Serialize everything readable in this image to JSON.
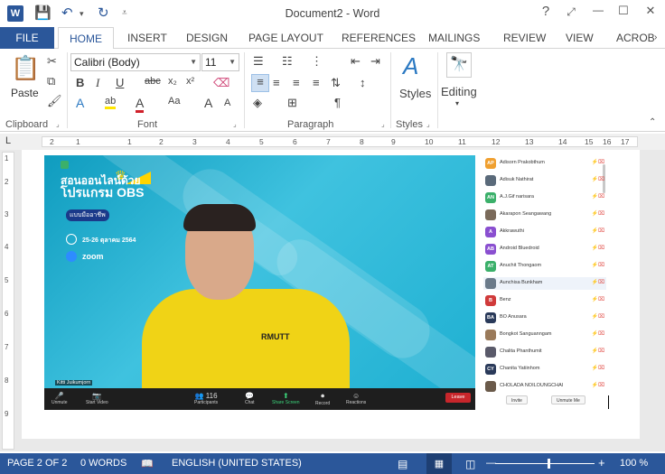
{
  "titlebar": {
    "app_icon": "W",
    "title": "Document2 - Word",
    "help": "?",
    "restore_ribbon": "⤢",
    "minimize": "—",
    "maximize": "☐",
    "close": "✕"
  },
  "tabs": {
    "file": "FILE",
    "items": [
      "HOME",
      "INSERT",
      "DESIGN",
      "PAGE LAYOUT",
      "REFERENCES",
      "MAILINGS",
      "REVIEW",
      "VIEW",
      "ACROB"
    ]
  },
  "ribbon": {
    "clipboard": {
      "paste": "Paste",
      "label": "Clipboard"
    },
    "font": {
      "name": "Calibri (Body)",
      "size": "11",
      "label": "Font"
    },
    "paragraph": {
      "label": "Paragraph"
    },
    "styles": {
      "button": "Styles",
      "label": "Styles"
    },
    "editing": {
      "button": "Editing"
    }
  },
  "ruler": {
    "numbers": [
      "2",
      "1",
      "1",
      "2",
      "3",
      "4",
      "5",
      "6",
      "7",
      "8",
      "9",
      "10",
      "11",
      "12",
      "13",
      "14",
      "15",
      "16",
      "17"
    ],
    "vnumbers": [
      "1",
      "2",
      "3",
      "4",
      "5",
      "6",
      "7",
      "8",
      "9"
    ]
  },
  "zoom": {
    "poster_title_1": "สอนออนไลน์ด้วย",
    "poster_title_2": "โปรแกรม OBS",
    "poster_sub": "แบบมืออาชีพ",
    "poster_date": "25-26 ตุลาคม 2564",
    "poster_zoom": "zoom",
    "shirt_logo": "RMUTT",
    "name_tag": "Kitti Juikumjorn",
    "toolbar": [
      {
        "label": "Unmute",
        "icon": "🎤"
      },
      {
        "label": "Start Video",
        "icon": "📷"
      },
      {
        "label": "Participants",
        "icon": "👥 116"
      },
      {
        "label": "Chat",
        "icon": "💬"
      },
      {
        "label": "Share Screen",
        "icon": "⬆"
      },
      {
        "label": "Record",
        "icon": "⏺"
      },
      {
        "label": "Reactions",
        "icon": "☺"
      }
    ],
    "leave": "Leave",
    "participants": [
      {
        "initials": "AP",
        "name": "Adisorn Prakobthum",
        "color": "#f0a030"
      },
      {
        "initials": "",
        "name": "Adisuk Nathirat",
        "color": "#5a6a7a"
      },
      {
        "initials": "AN",
        "name": "A.J.Gif narisara",
        "color": "#3bb06a"
      },
      {
        "initials": "",
        "name": "Akarapon Seangawang",
        "color": "#7a6a5a"
      },
      {
        "initials": "A",
        "name": "Akkrawuthi",
        "color": "#8a4fd0"
      },
      {
        "initials": "AB",
        "name": "Android Bluedroid",
        "color": "#8a4fd0"
      },
      {
        "initials": "AT",
        "name": "Anuchit Thongaom",
        "color": "#3bb06a"
      },
      {
        "initials": "",
        "name": "Aunchisa Bunkham",
        "color": "#6a7a8a"
      },
      {
        "initials": "B",
        "name": "Benz",
        "color": "#d03a3a"
      },
      {
        "initials": "BA",
        "name": "BO Anusara",
        "color": "#2a3a5a"
      },
      {
        "initials": "",
        "name": "Bongkot Sanguanngam",
        "color": "#9a7a5a"
      },
      {
        "initials": "",
        "name": "Chalita Phanthumit",
        "color": "#5a5a6a"
      },
      {
        "initials": "CY",
        "name": "Chanita Yatiinhom",
        "color": "#2a3a5a"
      },
      {
        "initials": "",
        "name": "CHOLADA NOILOUNGCHAI",
        "color": "#6a5a4a"
      }
    ],
    "invite": "Invite",
    "unmute_me": "Unmute Me"
  },
  "statusbar": {
    "page": "PAGE 2 OF 2",
    "words": "0 WORDS",
    "language": "ENGLISH (UNITED STATES)",
    "zoom_level": "100 %",
    "zoom_minus": "—",
    "zoom_plus": "+"
  }
}
